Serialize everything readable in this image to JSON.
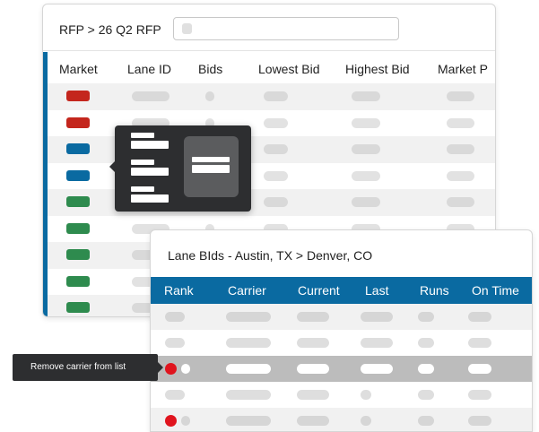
{
  "rfp_window": {
    "breadcrumb": "RFP > 26 Q2 RFP",
    "search_value": "",
    "columns": [
      "Market",
      "Lane ID",
      "Bids",
      "Lowest Bid",
      "Highest Bid",
      "Market P"
    ],
    "market_indicators": [
      "red",
      "red",
      "blue",
      "blue",
      "green",
      "green",
      "green",
      "green",
      "green"
    ]
  },
  "lane_window": {
    "title": "Lane BIds - Austin, TX > Denver, CO",
    "columns": [
      "Rank",
      "Carrier",
      "Current",
      "Last",
      "Runs",
      "On Time"
    ],
    "selected_row": 2,
    "rank_dot_rows": [
      2,
      4
    ]
  },
  "tooltip": {
    "text": "Remove carrier from list"
  },
  "colors": {
    "accent_blue": "#0a6aa1",
    "market_red": "#c4261d",
    "market_blue": "#0a6aa1",
    "market_green": "#2e8b4e",
    "rank_dot_red": "#e0141e",
    "dark_surface": "#2d2e30",
    "selected_row": "#bcbcbc"
  },
  "icons": {
    "popover_list": "list-icon",
    "popover_tile": "card-icon",
    "rank_dot": "status-dot-icon"
  }
}
